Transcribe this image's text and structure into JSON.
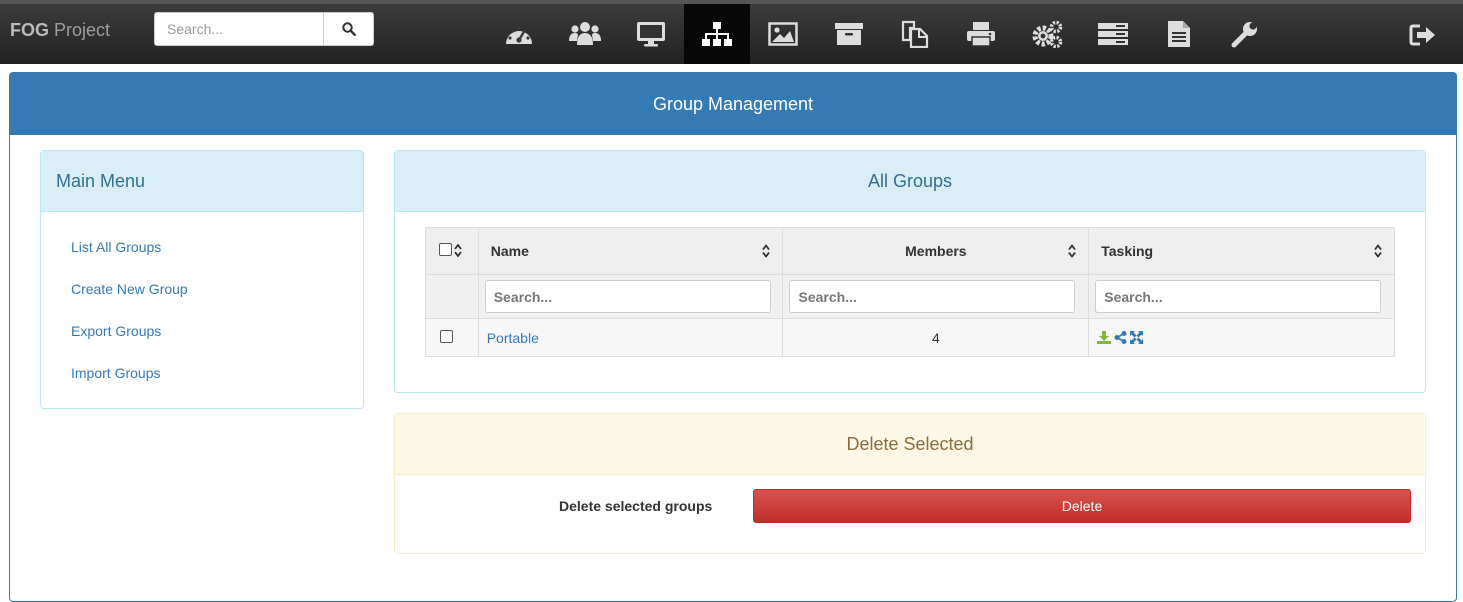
{
  "navbar": {
    "brand_bold": "FOG",
    "brand_rest": " Project",
    "search_placeholder": "Search...",
    "icons": [
      "dashboard-icon",
      "users-icon",
      "desktop-icon",
      "sitemap-icon",
      "image-icon",
      "archive-icon",
      "copy-icon",
      "print-icon",
      "cogs-icon",
      "server-icon",
      "document-icon",
      "wrench-icon"
    ],
    "active_icon": "sitemap-icon"
  },
  "main": {
    "title": "Group Management"
  },
  "menu": {
    "title": "Main Menu",
    "items": [
      {
        "label": "List All Groups"
      },
      {
        "label": "Create New Group"
      },
      {
        "label": "Export Groups"
      },
      {
        "label": "Import Groups"
      }
    ]
  },
  "groups": {
    "title": "All Groups",
    "columns": [
      "Name",
      "Members",
      "Tasking"
    ],
    "filter_placeholder": "Search...",
    "rows": [
      {
        "name": "Portable",
        "members": "4",
        "tasking_icons": [
          "download-icon",
          "share-icon",
          "expand-icon"
        ]
      }
    ]
  },
  "delete": {
    "title": "Delete Selected",
    "label": "Delete selected groups",
    "button": "Delete",
    "button_color": "#d9534f"
  },
  "colors": {
    "primary": "#337ab7",
    "info_bg": "#d9edf7",
    "warning_bg": "#fcf8e3"
  }
}
